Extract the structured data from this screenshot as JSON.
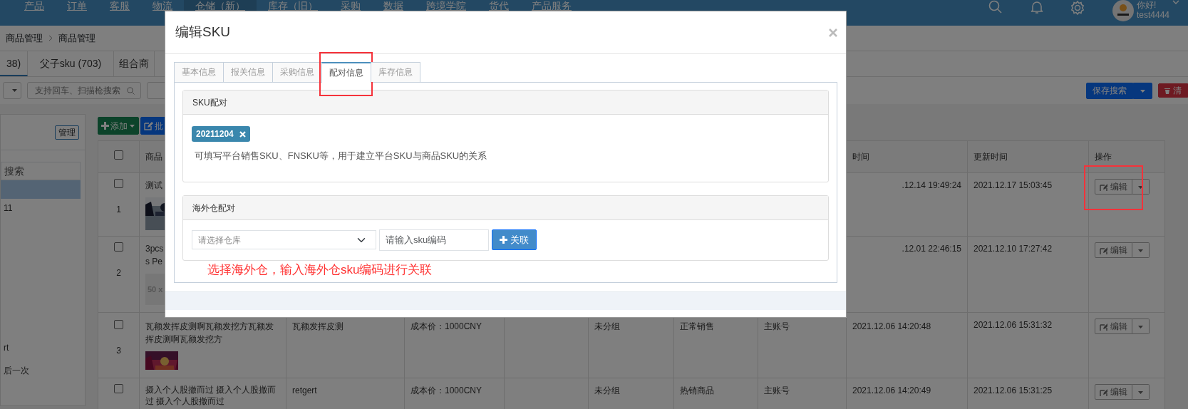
{
  "nav": {
    "items": [
      {
        "label": "产品",
        "selected": false
      },
      {
        "label": "订单",
        "selected": false
      },
      {
        "label": "客服",
        "selected": false
      },
      {
        "label": "物流",
        "selected": false
      },
      {
        "label": "仓储（新）",
        "selected": true
      },
      {
        "label": "库存（旧）",
        "selected": false
      },
      {
        "label": "采购",
        "selected": false
      },
      {
        "label": "数据",
        "selected": false
      },
      {
        "label": "跨境学院",
        "selected": false
      },
      {
        "label": "货代",
        "selected": false
      },
      {
        "label": "产品服务",
        "selected": false
      }
    ],
    "greeting": "你好!",
    "user": "test4444"
  },
  "breadcrumb": [
    "商品管理",
    "商品管理"
  ],
  "page_tabs": [
    {
      "label": "38)",
      "selected": true
    },
    {
      "label": "父子sku (703)",
      "selected": false
    },
    {
      "label": "组合商",
      "selected": false
    }
  ],
  "search": {
    "placeholder": "支持回车、扫描枪搜索"
  },
  "toolbar_right": {
    "save_search": "保存搜索",
    "clear": "清"
  },
  "sidebar": {
    "manage": "管理",
    "search": "搜索",
    "items": [
      {
        "selected": true
      },
      {
        "label": "11",
        "selected": false
      },
      {
        "label": "rt",
        "selected": false
      },
      {
        "label": "后一次",
        "selected": false
      }
    ]
  },
  "actions": {
    "add": "添加",
    "batch": "批"
  },
  "table": {
    "columns": [
      {
        "kind": "check",
        "checked": false
      },
      {
        "label": "商品"
      },
      {},
      {},
      {},
      {},
      {},
      {},
      {
        "label": "时间"
      },
      {
        "label": "更新时间"
      },
      {
        "label": "操作"
      }
    ],
    "rows": [
      {
        "index": "1",
        "checked": false,
        "name_lines": [
          "测试"
        ],
        "image": {
          "kind": "picture"
        },
        "created": ".12.14 19:49:24",
        "updated": "2021.12.17 15:03:45",
        "edit": "编辑",
        "highlighted": true
      },
      {
        "index": "2",
        "checked": false,
        "name_lines": [
          "3pcs",
          "s Pe"
        ],
        "image": {
          "kind": "placeholder",
          "text": "50 x"
        },
        "created": ".12.01 22:46:15",
        "updated": "2021.12.10 17:27:42",
        "edit": "编辑",
        "highlighted": false
      },
      {
        "index": "3",
        "checked": false,
        "name_lines": [
          "瓦额发挥皮测啊瓦额发挖方瓦额发挥皮测啊瓦额发挖方"
        ],
        "image": {
          "kind": "picture"
        },
        "sku": "瓦额发挥皮测",
        "cost": "成本价：1000CNY",
        "group": "未分组",
        "status": "正常销售",
        "account": "主账号",
        "created": "2021.12.06 14:20:48",
        "updated": "2021.12.06 15:31:32",
        "edit": "编辑",
        "highlighted": false
      },
      {
        "checked": false,
        "name_lines": [
          "摄入个人股撤而过 摄入个人股撤而过 摄入个人股撤而过"
        ],
        "sku": "retgert",
        "cost": "成本价：1000CNY",
        "group": "未分组",
        "status": "热销商品",
        "account": "主账号",
        "created": "2021.12.06 14:20:49",
        "updated": "2021.12.06 15:31:25",
        "edit": "编辑",
        "highlighted": false
      }
    ]
  },
  "modal": {
    "title": "编辑SKU",
    "tabs": [
      {
        "label": "基本信息",
        "selected": false,
        "highlighted": false
      },
      {
        "label": "报关信息",
        "selected": false,
        "highlighted": false
      },
      {
        "label": "采购信息",
        "selected": false,
        "highlighted": false
      },
      {
        "label": "配对信息",
        "selected": true,
        "highlighted": true
      },
      {
        "label": "库存信息",
        "selected": false,
        "highlighted": false
      }
    ],
    "sku_card": {
      "title": "SKU配对",
      "tags": [
        {
          "label": "20211204"
        }
      ],
      "help": "可填写平台销售SKU、FNSKU等，用于建立平台SKU与商品SKU的关系"
    },
    "warehouse_card": {
      "title": "海外仓配对",
      "select_placeholder": "请选择仓库",
      "input_placeholder": "请输入sku编码",
      "button": "关联"
    },
    "annotation": "选择海外仓，输入海外仓sku编码进行关联"
  }
}
